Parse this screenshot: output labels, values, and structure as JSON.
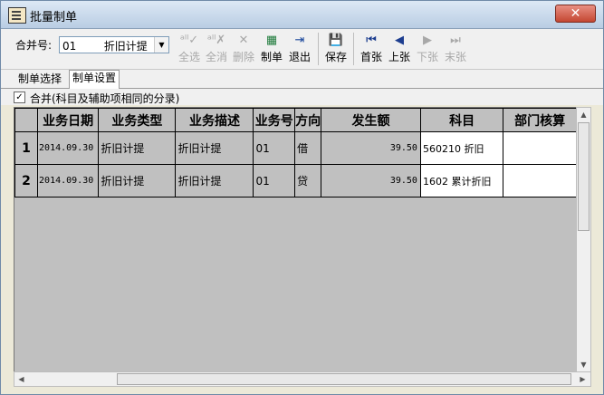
{
  "window": {
    "title": "批量制单",
    "close_label": "✕"
  },
  "toolbar": {
    "combo_label": "合并号:",
    "combo_value": "01        折旧计提",
    "buttons": [
      {
        "label": "全选",
        "icon": "select-all-icon",
        "glyph": "ᵃˡˡ✓",
        "enabled": false
      },
      {
        "label": "全消",
        "icon": "deselect-all-icon",
        "glyph": "ᵃˡˡ✗",
        "enabled": false
      },
      {
        "label": "删除",
        "icon": "delete-icon",
        "glyph": "✕",
        "enabled": false
      },
      {
        "label": "制单",
        "icon": "voucher-icon",
        "glyph": "▦",
        "enabled": true
      },
      {
        "label": "退出",
        "icon": "exit-icon",
        "glyph": "⇥",
        "enabled": true
      },
      {
        "label": "保存",
        "icon": "save-icon",
        "glyph": "💾",
        "enabled": true
      },
      {
        "label": "首张",
        "icon": "first-icon",
        "glyph": "⏮",
        "enabled": true
      },
      {
        "label": "上张",
        "icon": "previous-icon",
        "glyph": "◀",
        "enabled": true
      },
      {
        "label": "下张",
        "icon": "next-icon",
        "glyph": "▶",
        "enabled": false
      },
      {
        "label": "末张",
        "icon": "last-icon",
        "glyph": "⏭",
        "enabled": false
      }
    ]
  },
  "tabs": [
    {
      "label": "制单选择",
      "active": false
    },
    {
      "label": "制单设置",
      "active": true
    }
  ],
  "options": {
    "merge_checked": true,
    "check_mark": "✓",
    "merge_label": "合并(科目及辅助项相同的分录)"
  },
  "grid": {
    "columns": [
      "",
      "业务日期",
      "业务类型",
      "业务描述",
      "业务号",
      "方向",
      "发生额",
      "科目",
      "部门核算"
    ],
    "rows": [
      {
        "no": "1",
        "date": "2014.09.30",
        "type": "折旧计提",
        "desc": "折旧计提",
        "biz_no": "01",
        "direction": "借",
        "amount": "39.50",
        "account": "560210   折旧",
        "dept": ""
      },
      {
        "no": "2",
        "date": "2014.09.30",
        "type": "折旧计提",
        "desc": "折旧计提",
        "biz_no": "01",
        "direction": "贷",
        "amount": "39.50",
        "account": "1602   累计折旧",
        "dept": ""
      }
    ]
  },
  "scrollbars": {
    "up": "▲",
    "down": "▼",
    "left": "◀",
    "right": "▶"
  }
}
